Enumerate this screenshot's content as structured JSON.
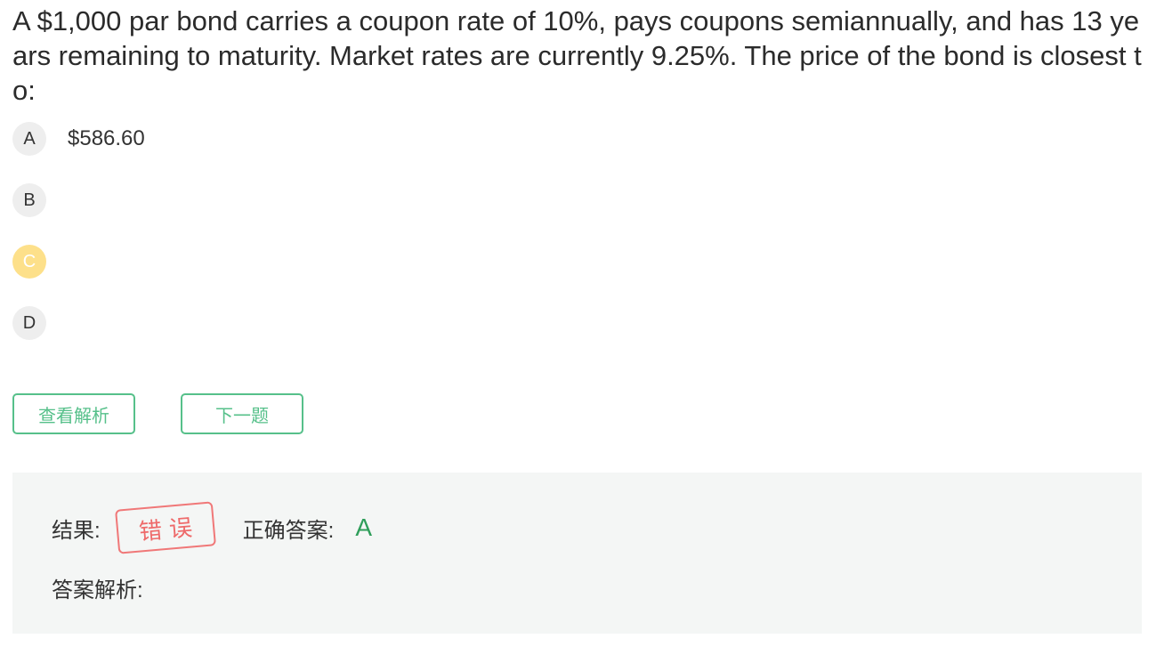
{
  "question": {
    "text": "A $1,000 par bond carries a coupon rate of 10%, pays coupons semiannually, and has 13 years remaining to maturity. Market rates are currently 9.25%. The price of the bond is closest to:"
  },
  "options": [
    {
      "letter": "A",
      "text": "$586.60",
      "selected": false
    },
    {
      "letter": "B",
      "text": "",
      "selected": false
    },
    {
      "letter": "C",
      "text": "",
      "selected": true
    },
    {
      "letter": "D",
      "text": "",
      "selected": false
    }
  ],
  "buttons": {
    "view_analysis": "查看解析",
    "next_question": "下一题"
  },
  "result": {
    "result_label": "结果:",
    "result_stamp": "错误",
    "correct_answer_label": "正确答案:",
    "correct_answer_value": "A",
    "analysis_label": "答案解析:"
  },
  "colors": {
    "accent_green": "#56c08a",
    "correct_green": "#2f9e5a",
    "selected_option": "#fde08a",
    "wrong_red": "#ee6a6a",
    "panel_background": "#f4f6f5"
  }
}
